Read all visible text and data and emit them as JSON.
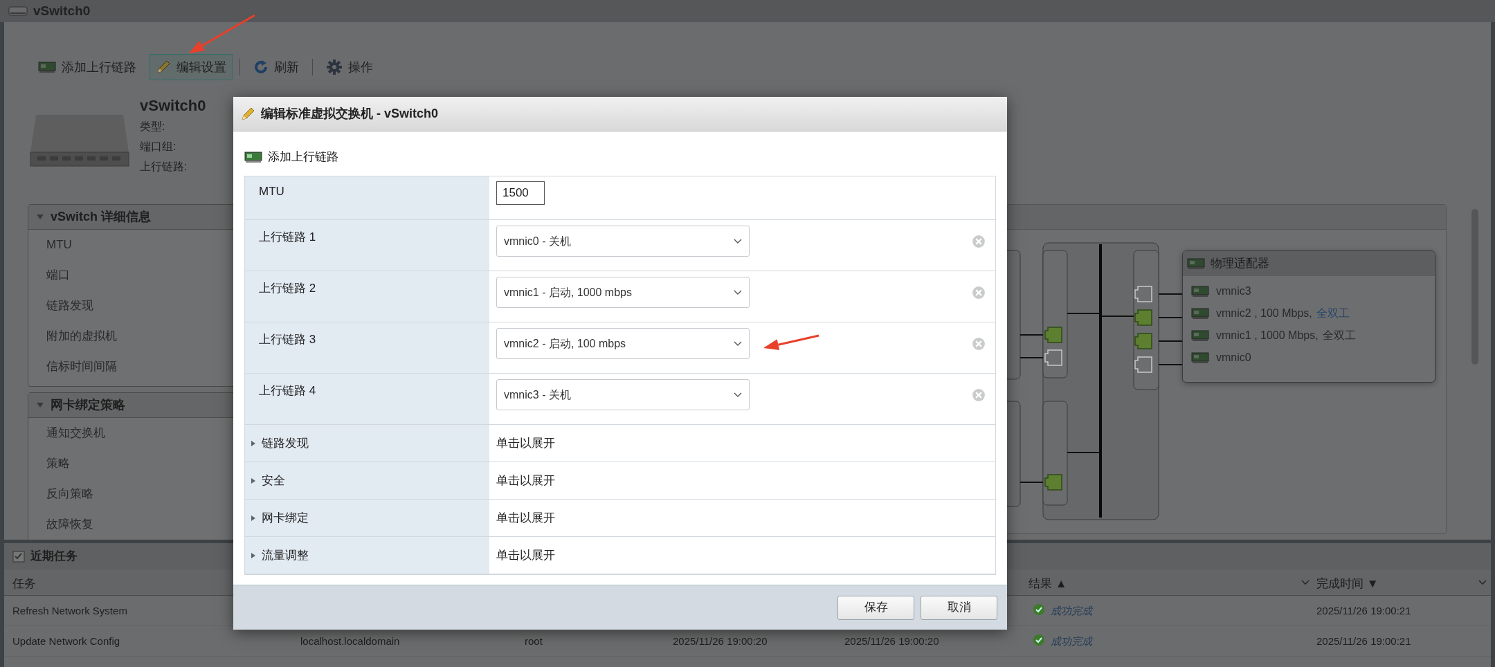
{
  "window": {
    "title": "vSwitch0"
  },
  "toolbar": [
    {
      "kind": "uplink",
      "label": "添加上行链路",
      "selected": false
    },
    {
      "kind": "edit",
      "label": "编辑设置",
      "selected": true
    },
    {
      "kind": "refresh",
      "label": "刷新",
      "selected": false
    },
    {
      "kind": "gear",
      "label": "操作",
      "selected": false
    }
  ],
  "summary": {
    "name": "vSwitch0",
    "fields": [
      "类型:",
      "端口组:",
      "上行链路:"
    ]
  },
  "panels": [
    {
      "title": "vSwitch 详细信息",
      "expanded": true,
      "items": [
        "MTU",
        "端口",
        "链路发现",
        "附加的虚拟机",
        "信标时间间隔"
      ]
    },
    {
      "title": "网卡绑定策略",
      "expanded": true,
      "items": [
        "通知交换机",
        "策略",
        "反向策略",
        "故障恢复"
      ]
    }
  ],
  "diagram": {
    "left_ports": [
      {
        "connected": true
      },
      {
        "connected": false
      },
      {
        "connected": true
      }
    ],
    "right_ports": [
      {
        "connected": false
      },
      {
        "connected": true
      },
      {
        "connected": true
      },
      {
        "connected": false
      }
    ],
    "adapters_title": "物理适配器",
    "adapters": [
      {
        "name": "vmnic3"
      },
      {
        "name": "vmnic2 , 100 Mbps,",
        "duplex": "全双工",
        "duplex_link": true
      },
      {
        "name": "vmnic1 , 1000 Mbps,",
        "duplex": "全双工",
        "duplex_link": false
      },
      {
        "name": "vmnic0"
      }
    ]
  },
  "tasks": {
    "title": "近期任务",
    "columns": [
      {
        "label": "任务"
      },
      {
        "label": "结果 ▲"
      },
      {
        "label": "完成时间 ▼"
      }
    ],
    "rows": [
      {
        "task": "Refresh Network System",
        "result": "成功完成",
        "completed": "2025/11/26 19:00:21"
      },
      {
        "task": "Update Network Config",
        "column_2": "localhost.localdomain",
        "column_3": "root",
        "column_4": "2025/11/26 19:00:20",
        "column_5": "2025/11/26 19:00:20",
        "result": "成功完成",
        "completed": "2025/11/26 19:00:21"
      }
    ]
  },
  "dialog": {
    "title": "编辑标准虚拟交换机 - vSwitch0",
    "add_uplink": "添加上行链路",
    "mtu": {
      "label": "MTU",
      "value": "1500"
    },
    "uplinks": [
      {
        "label": "上行链路 1",
        "value": "vmnic0 - 关机"
      },
      {
        "label": "上行链路 2",
        "value": "vmnic1 - 启动, 1000 mbps"
      },
      {
        "label": "上行链路 3",
        "value": "vmnic2 - 启动, 100 mbps"
      },
      {
        "label": "上行链路 4",
        "value": "vmnic3 - 关机"
      }
    ],
    "sections": [
      {
        "label": "链路发现",
        "hint": "单击以展开",
        "expanded": false
      },
      {
        "label": "安全",
        "hint": "单击以展开",
        "expanded": false
      },
      {
        "label": "网卡绑定",
        "hint": "单击以展开",
        "expanded": false
      },
      {
        "label": "流量调整",
        "hint": "单击以展开",
        "expanded": false
      }
    ],
    "buttons": [
      {
        "label": "保存"
      },
      {
        "label": "取消"
      }
    ]
  }
}
